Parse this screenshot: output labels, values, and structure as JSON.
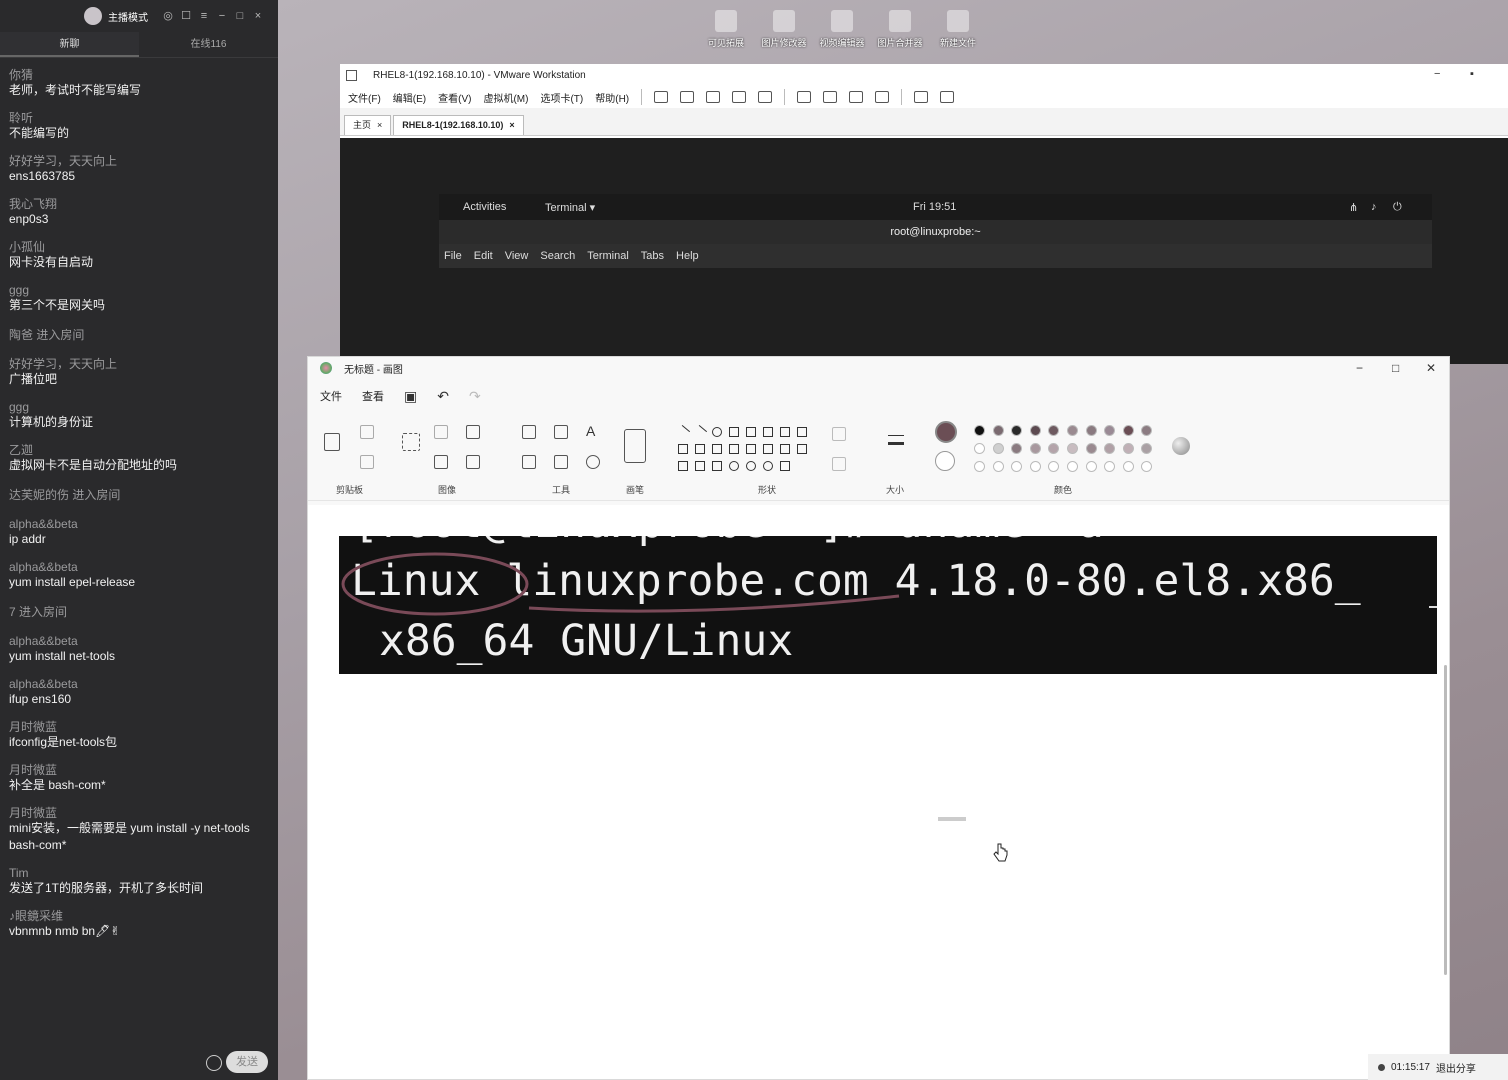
{
  "desktop": {
    "icons": [
      "可见拓展",
      "图片修改器",
      "视频编辑器",
      "图片合并器",
      "新建文件"
    ]
  },
  "chat": {
    "header_title": "主播模式",
    "tabs": [
      "新聊",
      "在线116"
    ],
    "messages": [
      {
        "name": "你猜",
        "text": "老师，考试时不能写编写"
      },
      {
        "name": "聆听",
        "text": "不能编写的"
      },
      {
        "name": "好好学习，天天向上",
        "text": "ens1663785"
      },
      {
        "name": "我心飞翔",
        "text": "enp0s3"
      },
      {
        "name": "小孤仙",
        "text": "网卡没有自启动"
      },
      {
        "name": "ggg",
        "text": "第三个不是网关吗"
      },
      {
        "system": "陶爸 进入房间"
      },
      {
        "name": "好好学习，天天向上",
        "text": "广播位吧"
      },
      {
        "name": "ggg",
        "text": "计算机的身份证"
      },
      {
        "name": "乙迦",
        "text": "虚拟网卡不是自动分配地址的吗"
      },
      {
        "system": "达芙妮的伤 进入房间"
      },
      {
        "name": "alpha&&beta",
        "text": "ip addr"
      },
      {
        "name": "alpha&&beta",
        "text": "yum install epel-release"
      },
      {
        "system": "7 进入房间"
      },
      {
        "name": "alpha&&beta",
        "text": "yum install net-tools"
      },
      {
        "name": "alpha&&beta",
        "text": "ifup ens160"
      },
      {
        "name": "月时微蓝",
        "text": "ifconfig是net-tools包"
      },
      {
        "name": "月时微蓝",
        "text": "补全是 bash-com*"
      },
      {
        "name": "月时微蓝",
        "text": "mini安装，一般需要是 yum install -y net-tools bash-com*"
      },
      {
        "name": "Tim",
        "text": "发送了1T的服务器，开机了多长时间"
      },
      {
        "name": "♪眼鏡采维",
        "text": "vbnmnb nmb bn🖊✌"
      }
    ],
    "send_label": "发送"
  },
  "vmware": {
    "title": "RHEL8-1(192.168.10.10) - VMware Workstation",
    "menu": [
      "文件(F)",
      "编辑(E)",
      "查看(V)",
      "虚拟机(M)",
      "选项卡(T)",
      "帮助(H)"
    ],
    "tabs": [
      "主页",
      "RHEL8-1(192.168.10.10)"
    ],
    "gnome": {
      "activities": "Activities",
      "app": "Terminal ▾",
      "clock": "Fri 19:51"
    },
    "terminal_title": "root@linuxprobe:~",
    "terminal_menu": [
      "File",
      "Edit",
      "View",
      "Search",
      "Terminal",
      "Tabs",
      "Help"
    ]
  },
  "paint": {
    "title": "无标题 - 画图",
    "menu": [
      "文件",
      "查看"
    ],
    "groups": [
      "剪贴板",
      "图像",
      "工具",
      "画笔",
      "形状",
      "大小",
      "颜色"
    ],
    "colors": {
      "primary": "#6b4e55",
      "row1": [
        "#111111",
        "#7a6a70",
        "#2a2a2a",
        "#5c4a50",
        "#6e5a60",
        "#9a8a90",
        "#8a7a80",
        "#9a8a95",
        "#6b4e55",
        "#8c7c82"
      ],
      "row2": [
        "#ffffff",
        "#cfcfcf",
        "#8a7a80",
        "#a8989e",
        "#b4a4aa",
        "#c8bcc0",
        "#9a8a90",
        "#b0a0a6",
        "#c0b0b6",
        "#aaa0a4"
      ]
    },
    "canvas_text": {
      "line0": "[root@linuxprobe ~]# uname -a",
      "line1": "Linux linuxprobe.com 4.18.0-80.el8.x86_",
      "line2": "x86_64 GNU/Linux"
    }
  },
  "status": {
    "time": "01:15:17",
    "exit_label": "退出分享"
  }
}
